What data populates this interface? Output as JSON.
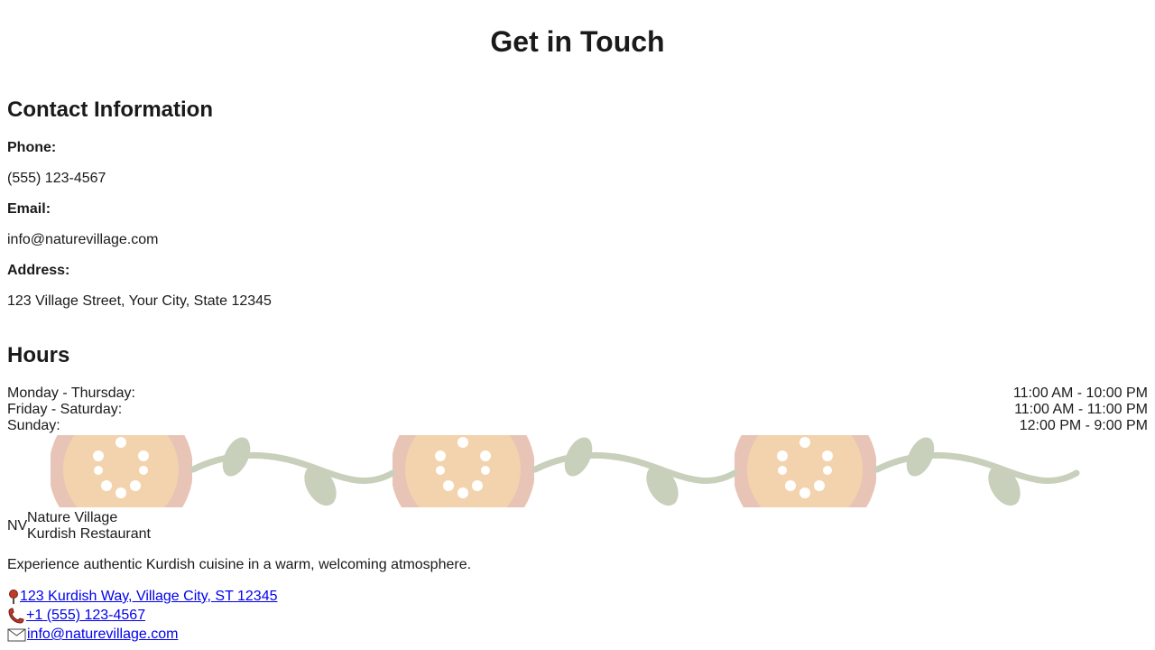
{
  "page": {
    "title": "Get in Touch"
  },
  "contact": {
    "heading": "Contact Information",
    "phone_label": "Phone:",
    "phone_value": "(555) 123-4567",
    "email_label": "Email:",
    "email_value": "info@naturevillage.com",
    "address_label": "Address:",
    "address_value": "123 Village Street, Your City, State 12345"
  },
  "hours": {
    "heading": "Hours",
    "rows": [
      {
        "day": "Monday - Thursday:",
        "time": "11:00 AM - 10:00 PM"
      },
      {
        "day": "Friday - Saturday:",
        "time": "11:00 AM - 11:00 PM"
      },
      {
        "day": "Sunday:",
        "time": "12:00 PM - 9:00 PM"
      }
    ]
  },
  "footer": {
    "logo_text": "NV",
    "name_line1": "Nature Village",
    "name_line2": "Kurdish Restaurant",
    "tagline": "Experience authentic Kurdish cuisine in a warm, welcoming atmosphere.",
    "address_link": "123 Kurdish Way, Village City, ST 12345",
    "phone_link": "+1 (555) 123-4567",
    "email_link": "info@naturevillage.com",
    "icons": {
      "address": "map-pin-icon",
      "phone": "phone-icon",
      "email": "envelope-icon"
    }
  },
  "colors": {
    "bread_outer": "#e8c4b6",
    "bread_inner": "#f2d3ad",
    "vine": "#c8d0bb",
    "dots": "#ffffff",
    "link": "#0000ee",
    "pin": "#c0392b"
  }
}
